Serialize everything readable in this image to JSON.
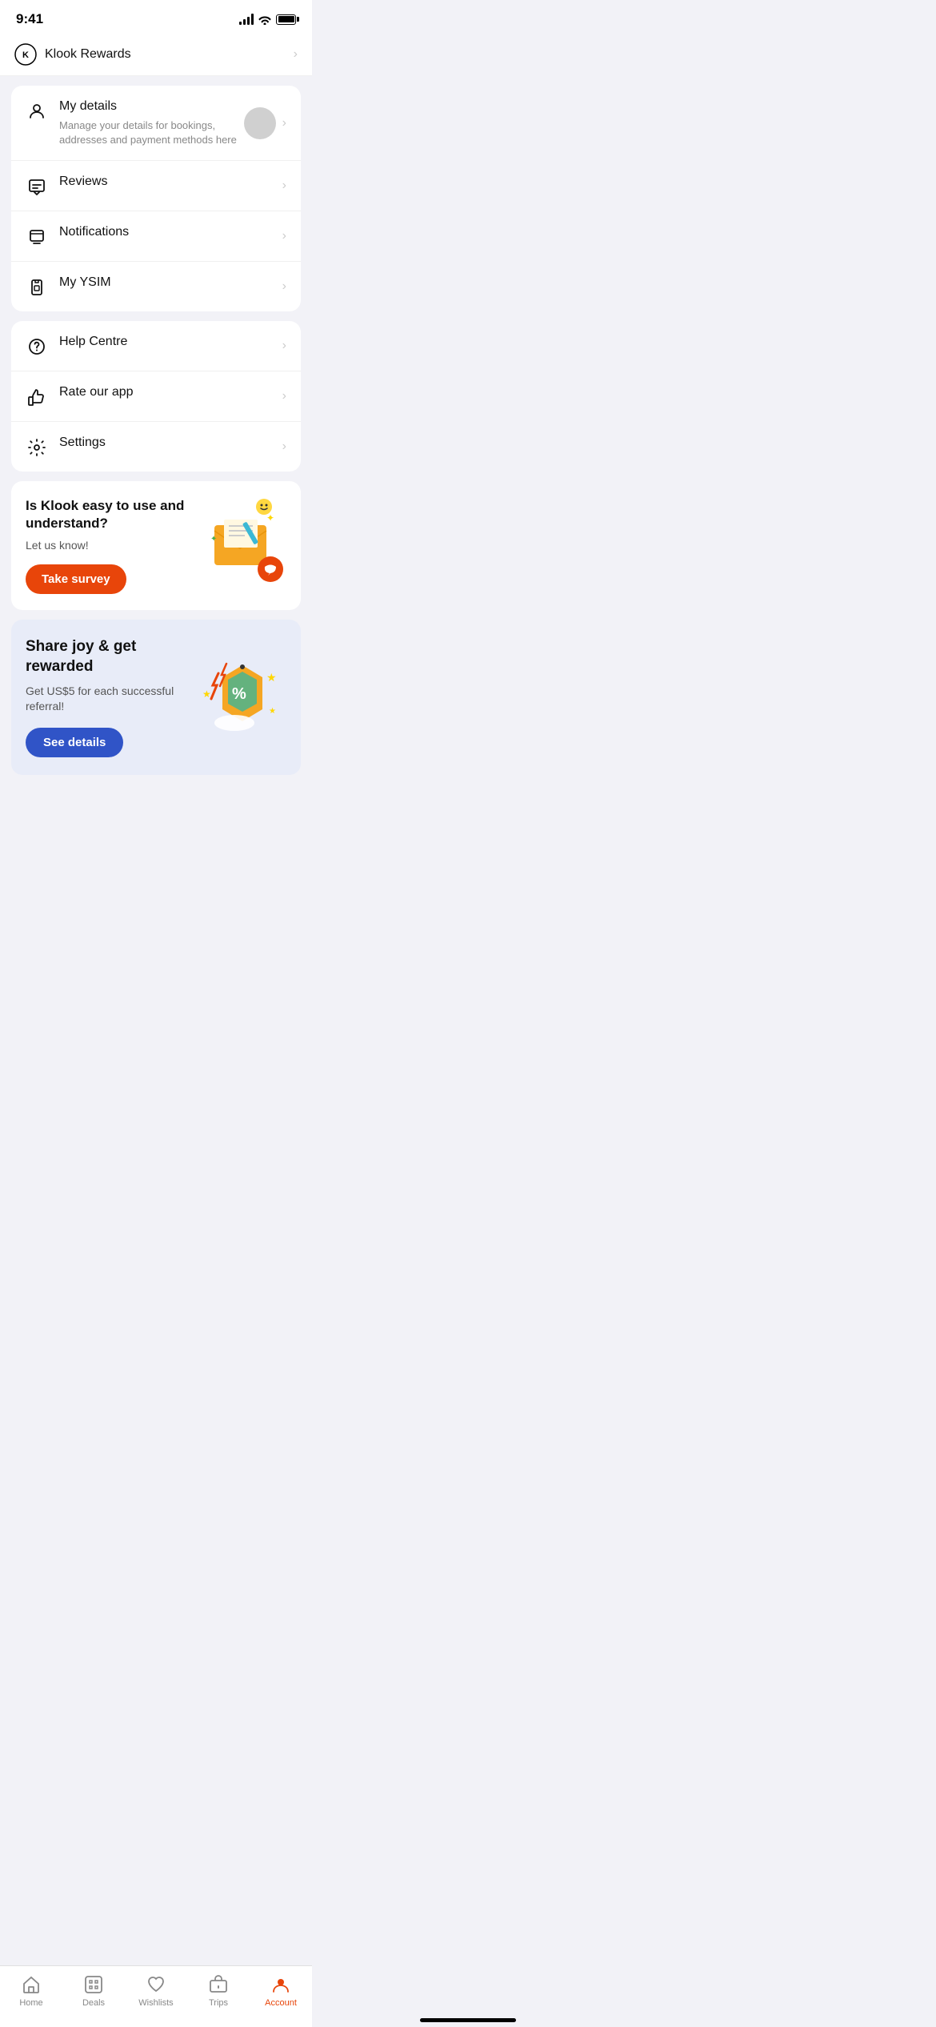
{
  "statusBar": {
    "time": "9:41"
  },
  "klookRewards": {
    "label": "Klook Rewards"
  },
  "menuSections": [
    {
      "id": "section1",
      "items": [
        {
          "id": "my-details",
          "icon": "person",
          "title": "My details",
          "subtitle": "Manage your details for bookings, addresses and payment methods here",
          "hasSubtitle": true
        },
        {
          "id": "reviews",
          "icon": "reviews",
          "title": "Reviews",
          "subtitle": "",
          "hasSubtitle": false
        },
        {
          "id": "notifications",
          "icon": "notifications",
          "title": "Notifications",
          "subtitle": "",
          "hasSubtitle": false
        },
        {
          "id": "my-ysim",
          "icon": "ysim",
          "title": "My YSIM",
          "subtitle": "",
          "hasSubtitle": false
        }
      ]
    },
    {
      "id": "section2",
      "items": [
        {
          "id": "help-centre",
          "icon": "help",
          "title": "Help Centre",
          "subtitle": "",
          "hasSubtitle": false
        },
        {
          "id": "rate-app",
          "icon": "thumbsup",
          "title": "Rate our app",
          "subtitle": "",
          "hasSubtitle": false
        },
        {
          "id": "settings",
          "icon": "settings",
          "title": "Settings",
          "subtitle": "",
          "hasSubtitle": false
        }
      ]
    }
  ],
  "surveyCard": {
    "title": "Is Klook easy to use and understand?",
    "subtitle": "Let us know!",
    "buttonLabel": "Take survey"
  },
  "referralCard": {
    "title": "Share joy & get rewarded",
    "subtitle": "Get US$5 for each successful referral!",
    "buttonLabel": "See details"
  },
  "bottomNav": {
    "items": [
      {
        "id": "home",
        "label": "Home",
        "active": false
      },
      {
        "id": "deals",
        "label": "Deals",
        "active": false
      },
      {
        "id": "wishlists",
        "label": "Wishlists",
        "active": false
      },
      {
        "id": "trips",
        "label": "Trips",
        "active": false
      },
      {
        "id": "account",
        "label": "Account",
        "active": true
      }
    ]
  }
}
